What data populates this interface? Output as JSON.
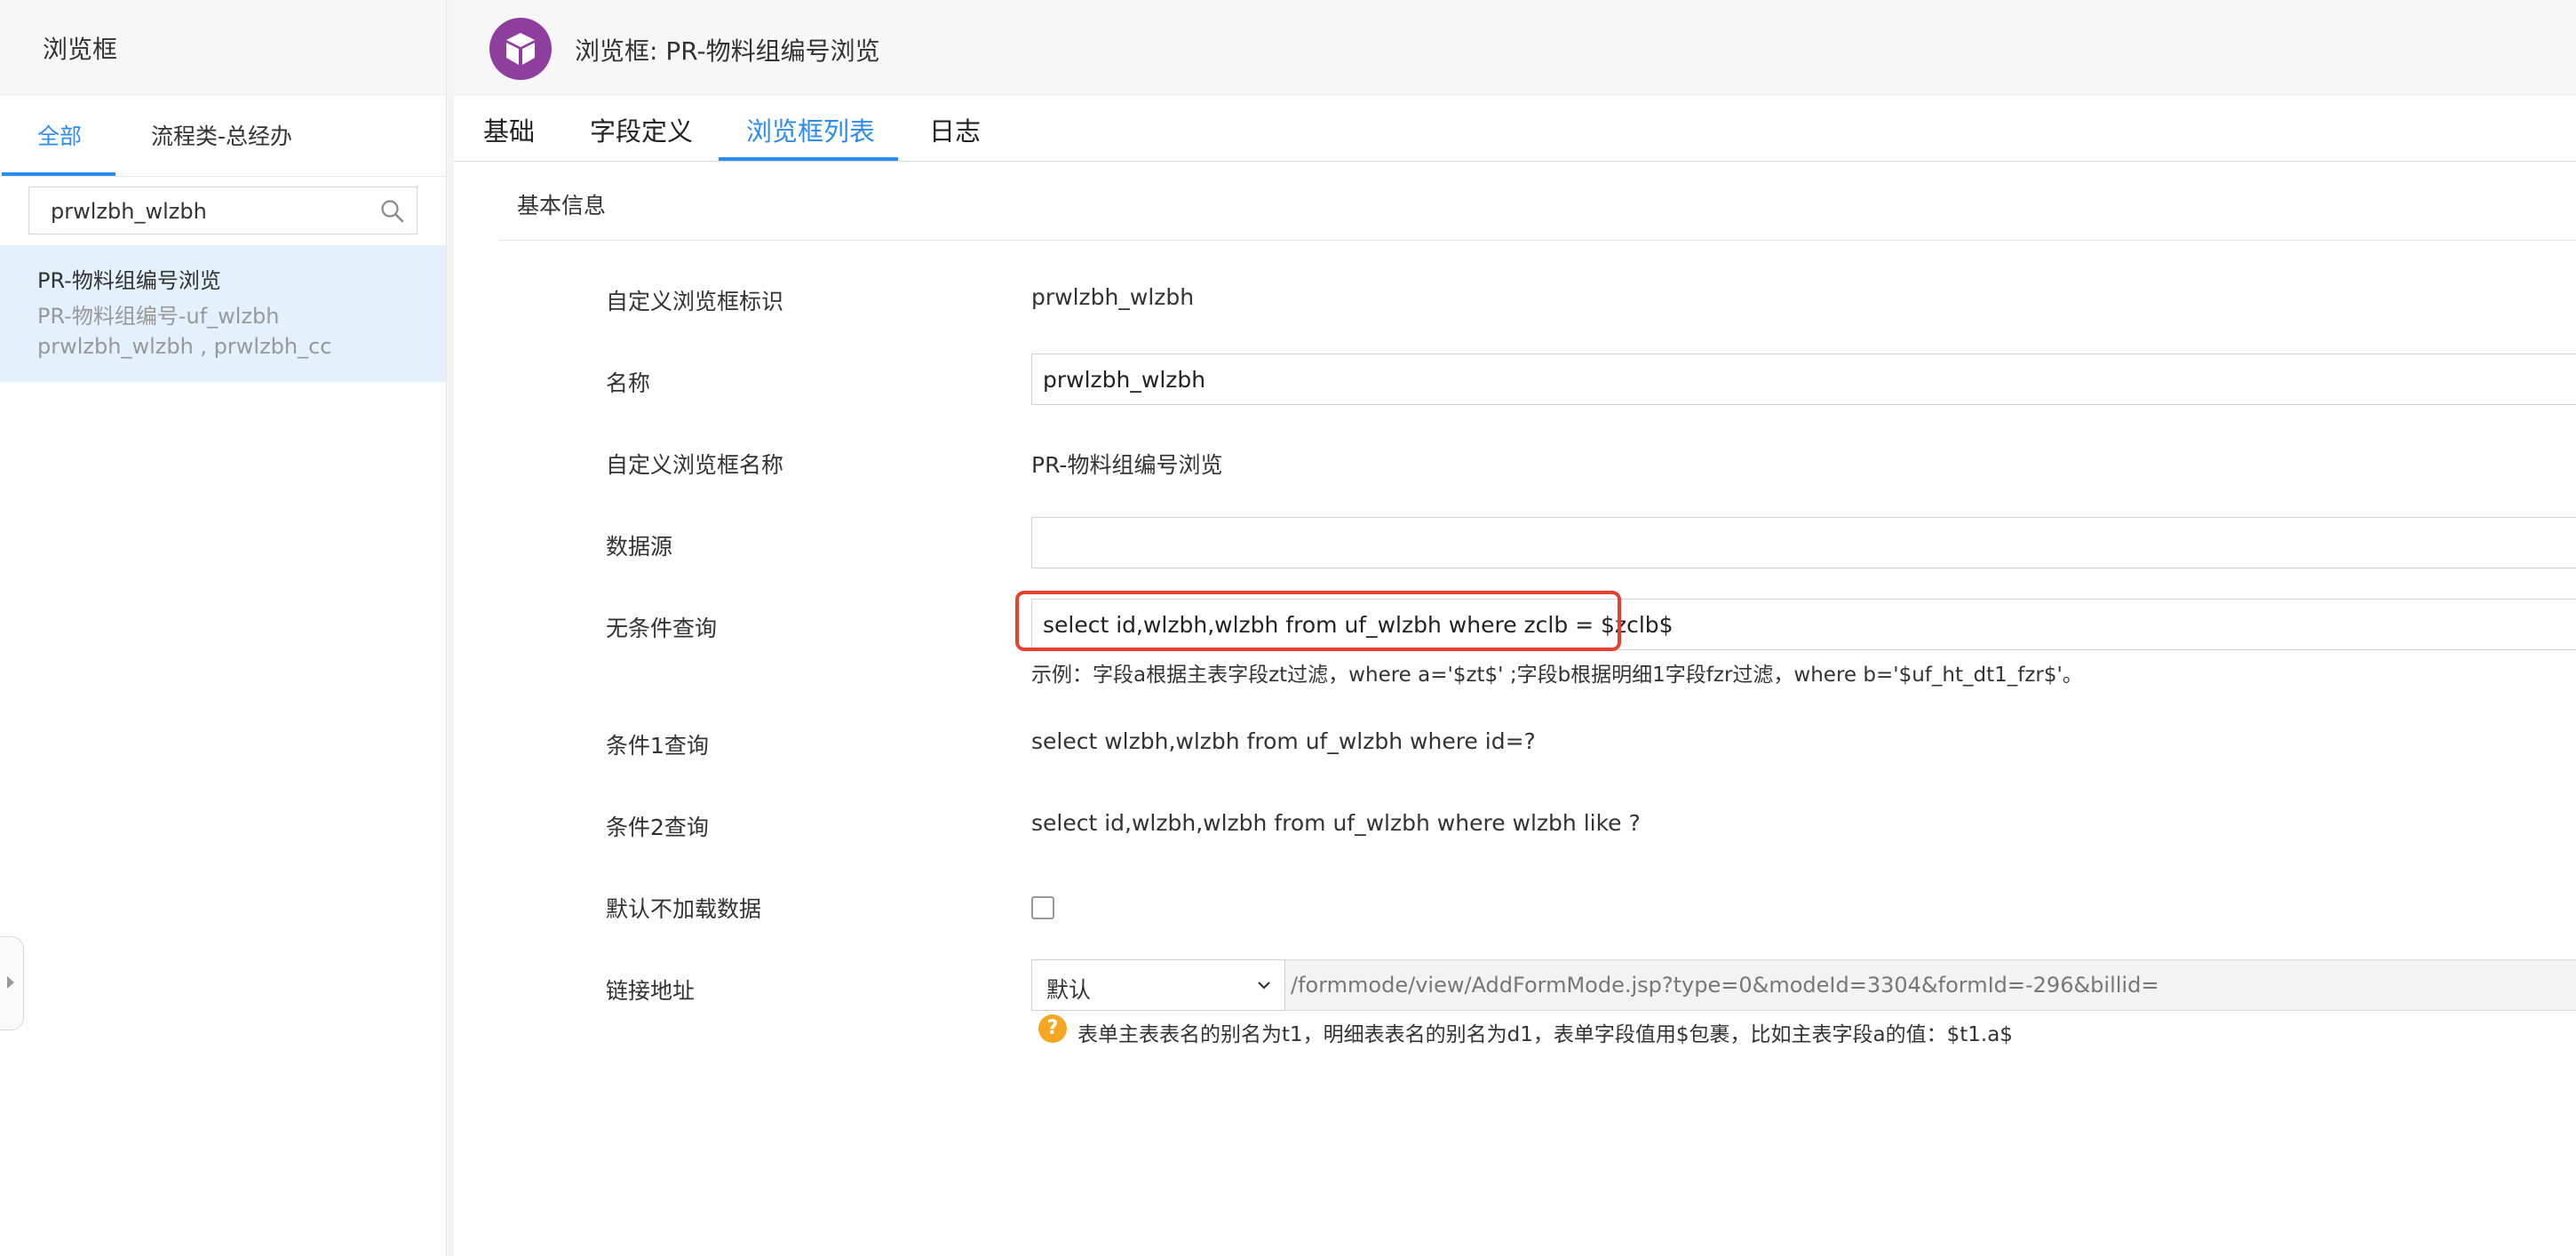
{
  "sidebar": {
    "title": "浏览框",
    "tabs": [
      {
        "label": "全部",
        "active": true
      },
      {
        "label": "流程类-总经办",
        "active": false
      }
    ],
    "search": {
      "value": "prwlzbh_wlzbh",
      "icon": "search-icon"
    },
    "items": [
      {
        "name": "PR-物料组编号浏览",
        "subtitle": "PR-物料组编号-uf_wlzbh",
        "fields": "prwlzbh_wlzbh , prwlzbh_cc"
      }
    ]
  },
  "header": {
    "icon": "cube-icon",
    "title": "浏览框: PR-物料组编号浏览"
  },
  "tabs": [
    {
      "label": "基础",
      "active": false
    },
    {
      "label": "字段定义",
      "active": false
    },
    {
      "label": "浏览框列表",
      "active": true
    },
    {
      "label": "日志",
      "active": false
    }
  ],
  "section": {
    "title": "基本信息"
  },
  "form": {
    "identifier": {
      "label": "自定义浏览框标识",
      "value": "prwlzbh_wlzbh"
    },
    "name": {
      "label": "名称",
      "value": "prwlzbh_wlzbh"
    },
    "display_name": {
      "label": "自定义浏览框名称",
      "value": "PR-物料组编号浏览"
    },
    "datasource": {
      "label": "数据源",
      "value": ""
    },
    "unconditional_query": {
      "label": "无条件查询",
      "value": "select id,wlzbh,wlzbh from uf_wlzbh where zclb = $zclb$",
      "hint": "示例：字段a根据主表字段zt过滤，where a='$zt$' ;字段b根据明细1字段fzr过滤，where b='$uf_ht_dt1_fzr$'。"
    },
    "condition1_query": {
      "label": "条件1查询",
      "value": "select wlzbh,wlzbh from uf_wlzbh where id=?"
    },
    "condition2_query": {
      "label": "条件2查询",
      "value": "select id,wlzbh,wlzbh from uf_wlzbh where wlzbh like ?"
    },
    "no_default_load": {
      "label": "默认不加载数据",
      "checked": false
    },
    "link": {
      "label": "链接地址",
      "select_value": "默认",
      "url": "/formmode/view/AddFormMode.jsp?type=0&modeId=3304&formId=-296&billid=",
      "help_icon": "question-icon",
      "help": "表单主表表名的别名为t1，明细表表名的别名为d1，表单字段值用$包裹，比如主表字段a的值：$t1.a$"
    }
  },
  "colors": {
    "accent": "#2d8cf0",
    "highlight": "#e7402f",
    "app_icon": "#8e3f9e",
    "selected_item": "#e4f0fb",
    "help_icon": "#f5a623"
  }
}
